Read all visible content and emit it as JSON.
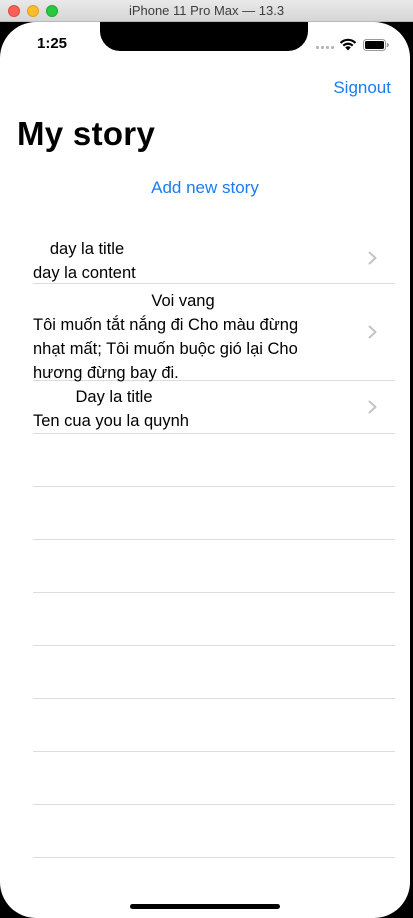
{
  "window": {
    "title": "iPhone 11 Pro Max — 13.3"
  },
  "status_bar": {
    "time": "1:25",
    "icons": [
      "cellular-signal-icon",
      "wifi-icon",
      "battery-icon"
    ]
  },
  "nav": {
    "signout_label": "Signout",
    "title": "My story",
    "add_story_label": "Add new story"
  },
  "stories": [
    {
      "title": "day la title",
      "content": "day la content"
    },
    {
      "title": "Voi vang",
      "content": "Tôi muốn tắt nắng đi Cho màu đừng nhạt mất; Tôi muốn buộc gió lại Cho hương đừng bay đi."
    },
    {
      "title": "Day la title",
      "content": "Ten cua you la quynh"
    }
  ],
  "colors": {
    "accent": "#1a7cf0",
    "separator": "#dcdcdc",
    "chevron": "#c4c4c7"
  }
}
